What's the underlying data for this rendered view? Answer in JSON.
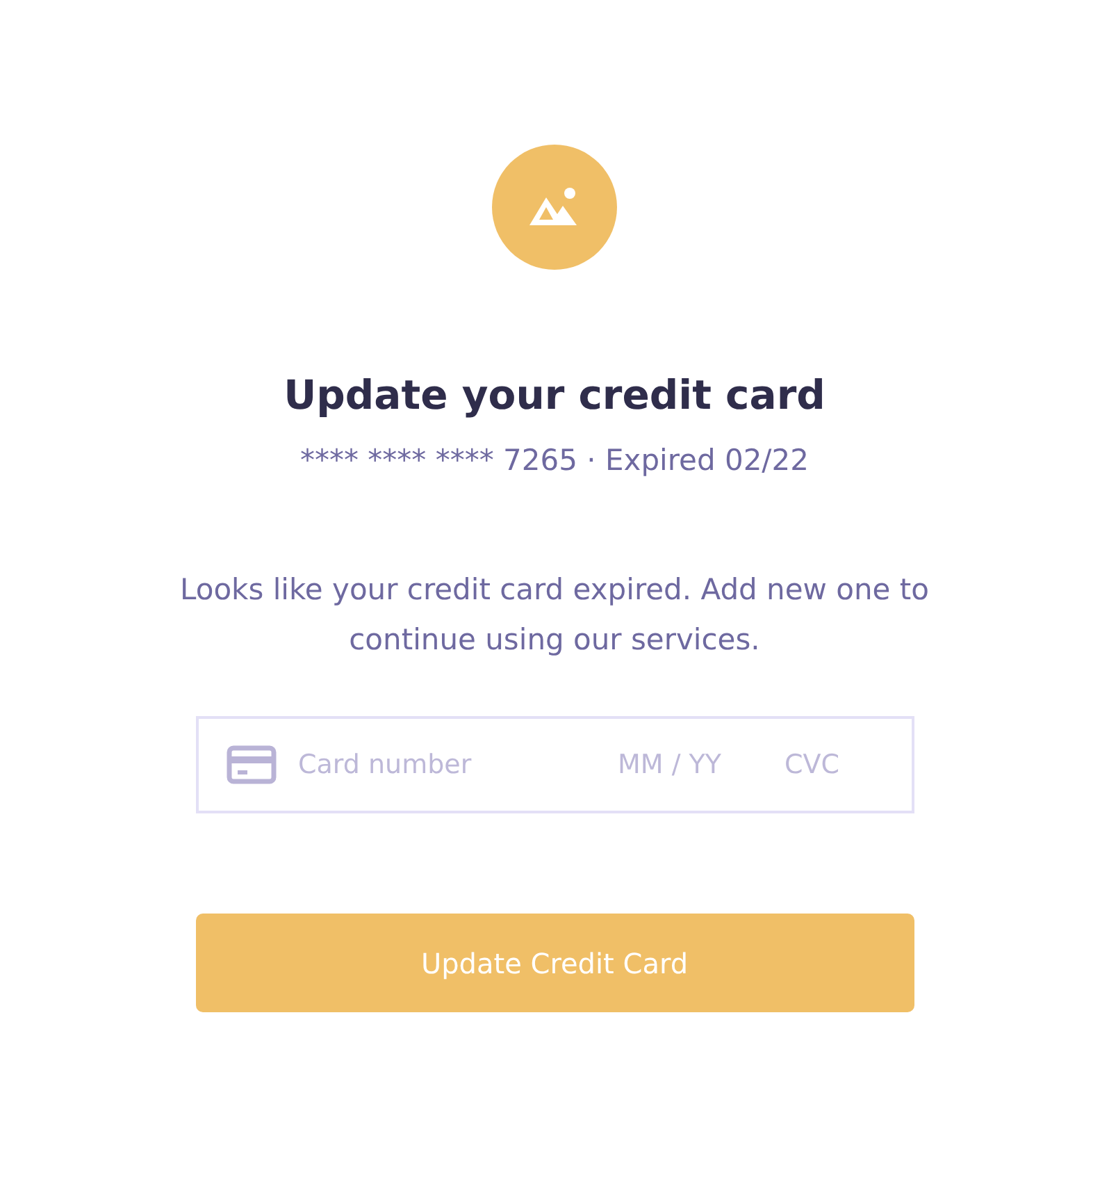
{
  "title": "Update your credit card",
  "card_summary": "**** **** **** 7265 · Expired 02/22",
  "message": "Looks like your credit card expired. Add new one to continue using our services.",
  "card_form": {
    "fields": [
      {
        "kind": "number",
        "placeholder": "Card number"
      },
      {
        "kind": "expiry",
        "placeholder": "MM / YY"
      },
      {
        "kind": "cvc",
        "placeholder": "CVC"
      }
    ]
  },
  "button": "Update Credit Card"
}
